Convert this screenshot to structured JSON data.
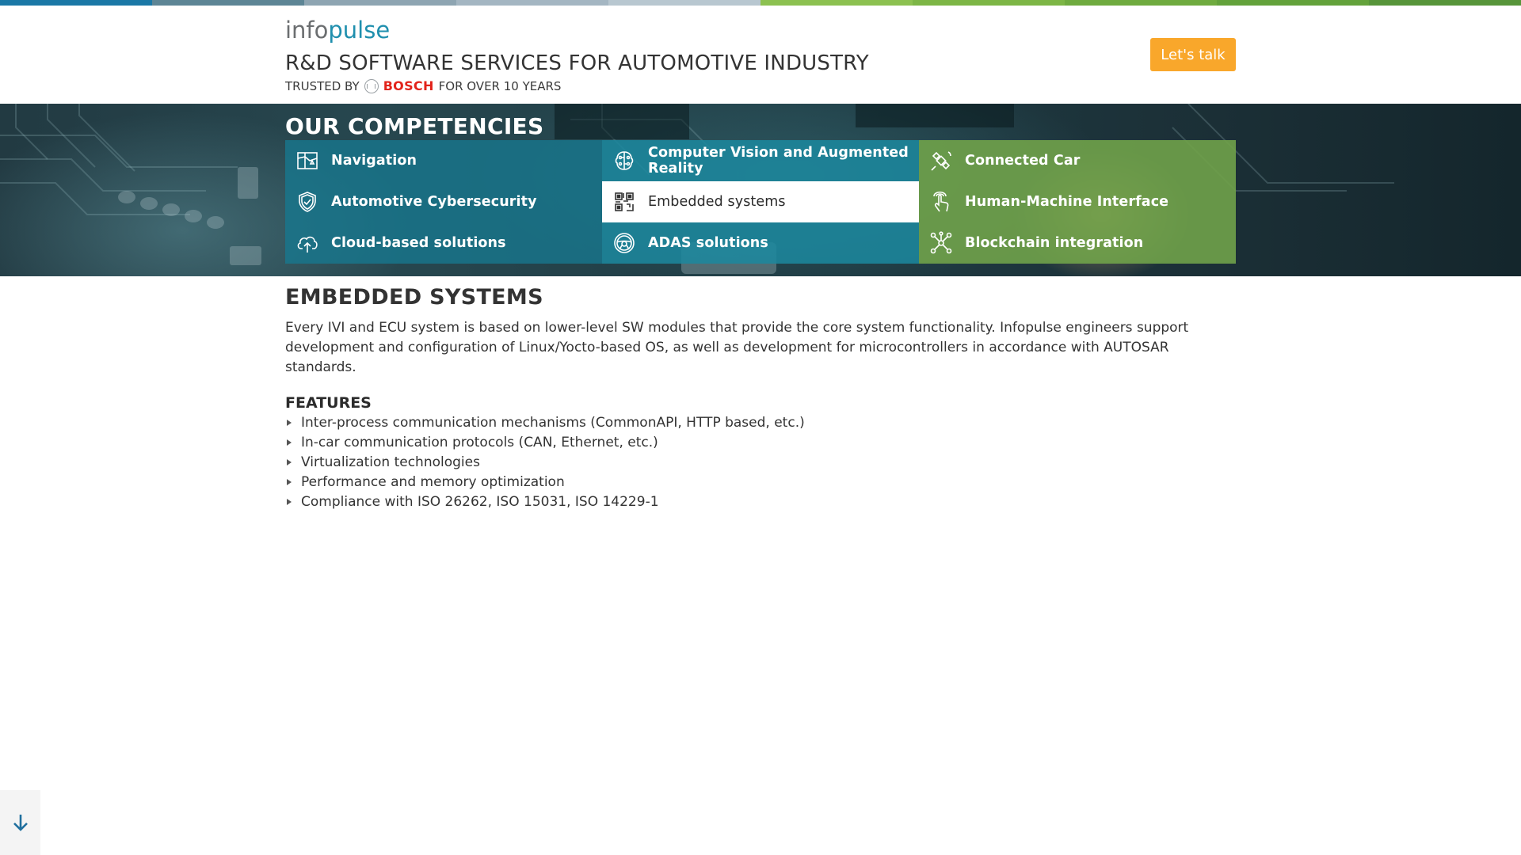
{
  "colors": {
    "top_stripes": [
      "#1a78a6",
      "#5d8595",
      "#8ea5b2",
      "#a4b6c2",
      "#b8c7d0",
      "#8cc150",
      "#7db646",
      "#6fab3f",
      "#63a23b",
      "#57953a"
    ],
    "accent_orange": "#f9a72b",
    "teal_dark": "#17798f",
    "teal": "#1c889e",
    "green": "#70a24a",
    "bosch_red": "#e2231a"
  },
  "header": {
    "logo_part1": "info",
    "logo_part2": "pulse",
    "headline": "R&D SOFTWARE SERVICES FOR AUTOMOTIVE INDUSTRY",
    "trusted_prefix": "TRUSTED BY",
    "trusted_brand": "BOSCH",
    "trusted_suffix": "FOR OVER 10 YEARS",
    "cta_label": "Let's talk"
  },
  "competencies": {
    "title": "OUR COMPETENCIES",
    "tiles": [
      {
        "label": "Navigation",
        "icon": "map-icon",
        "active": false
      },
      {
        "label": "Computer Vision and Augmented Reality",
        "icon": "brain-circuit-icon",
        "active": false
      },
      {
        "label": "Connected Car",
        "icon": "satellite-icon",
        "active": false
      },
      {
        "label": "Automotive Cybersecurity",
        "icon": "shield-check-icon",
        "active": false
      },
      {
        "label": "Embedded systems",
        "icon": "qr-code-icon",
        "active": true
      },
      {
        "label": "Human-Machine Interface",
        "icon": "touch-hand-icon",
        "active": false
      },
      {
        "label": "Cloud-based solutions",
        "icon": "cloud-upload-icon",
        "active": false
      },
      {
        "label": "ADAS solutions",
        "icon": "steering-wheel-icon",
        "active": false
      },
      {
        "label": "Blockchain integration",
        "icon": "network-nodes-icon",
        "active": false
      }
    ]
  },
  "detail": {
    "title": "EMBEDDED SYSTEMS",
    "description": "Every IVI and ECU system is based on lower-level SW modules that provide the core system functionality. Infopulse engineers support development and configuration of Linux/Yocto-based OS, as well as development for microcontrollers in accordance with AUTOSAR standards.",
    "features_title": "FEATURES",
    "features": [
      "Inter-process communication mechanisms (CommonAPI, HTTP based, etc.)",
      "In-car communication protocols (CAN, Ethernet, etc.)",
      "Virtualization technologies",
      "Performance and memory optimization",
      "Compliance with ISO 26262, ISO 15031, ISO 14229-1"
    ]
  },
  "scroll_button_icon": "arrow-down-icon"
}
